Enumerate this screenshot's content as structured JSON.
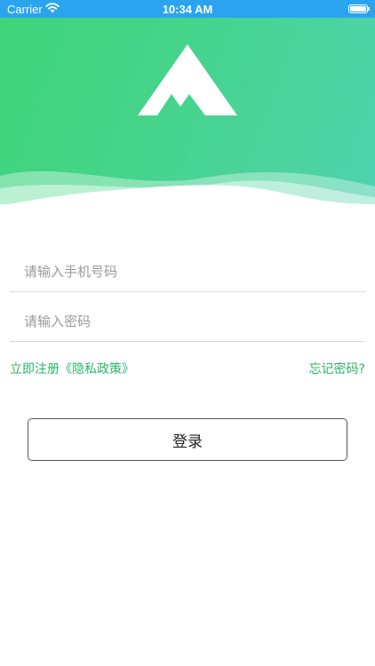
{
  "status_bar": {
    "carrier": "Carrier",
    "time": "10:34 AM"
  },
  "login": {
    "phone_placeholder": "请输入手机号码",
    "password_placeholder": "请输入密码",
    "register_link": "立即注册《隐私政策》",
    "forgot_link": "忘记密码?",
    "submit_label": "登录"
  },
  "icons": {
    "logo": "mountain-logo-icon",
    "wifi": "wifi-icon",
    "battery": "battery-icon"
  },
  "colors": {
    "status_bar": "#2aa4ee",
    "header_start": "#3fd47a",
    "header_end": "#4fd2ad",
    "link": "#28b46a",
    "input_placeholder": "#9a9a9a"
  }
}
